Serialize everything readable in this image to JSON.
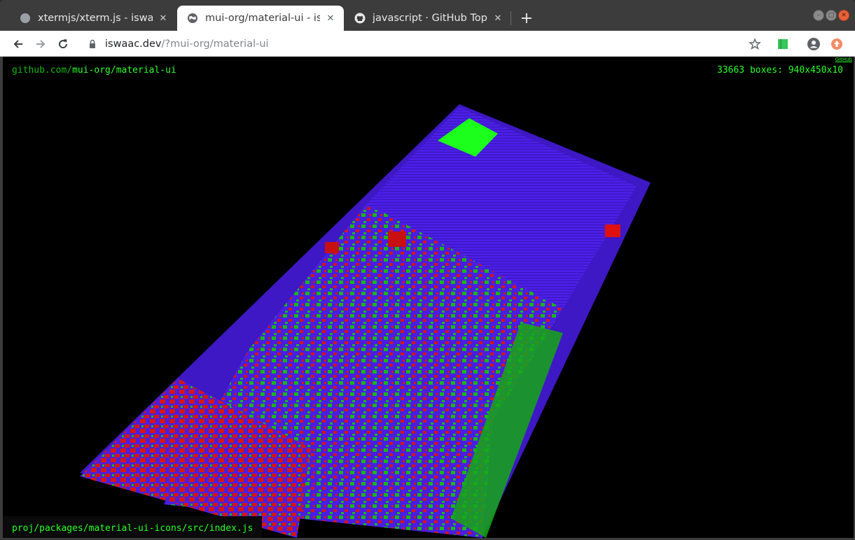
{
  "tabs": [
    {
      "title": "xtermjs/xterm.js - iswaac",
      "active": false,
      "icon": "globe-icon"
    },
    {
      "title": "mui-org/material-ui - iswa",
      "active": true,
      "icon": "globe-icon"
    },
    {
      "title": "javascript · GitHub Topics",
      "active": false,
      "icon": "github-icon"
    }
  ],
  "toolbar": {
    "url_host": "iswaac.dev",
    "url_path": "/?mui-org/material-ui"
  },
  "viewer": {
    "repo_host": "github.com/",
    "repo_path": "mui-org/material-ui",
    "github_link": "GitHub",
    "boxes_info": "33663 boxes: 940x450x10",
    "file_path": "proj/packages/material-ui-icons/src/index.js"
  },
  "colors": {
    "accent_green": "#30ff30",
    "box_blue": "#4a1ee0",
    "box_red": "#e01010",
    "box_green": "#10c010"
  }
}
